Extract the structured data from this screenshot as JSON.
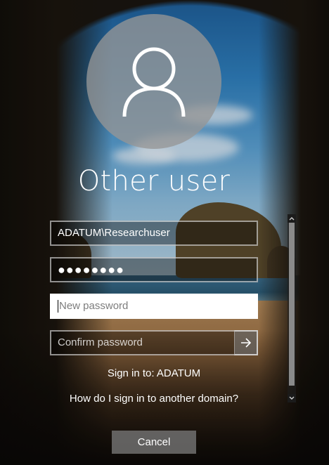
{
  "user": {
    "display_name": "Other user",
    "avatar_icon": "user-silhouette-icon"
  },
  "fields": {
    "username_value": "ADATUM\\Researchuser",
    "old_password_mask": "●●●●●●●●",
    "new_password_placeholder": "New password",
    "confirm_password_placeholder": "Confirm password",
    "submit_icon": "arrow-right-icon"
  },
  "signin_to": "Sign in to: ADATUM",
  "help_link": "How do I sign in to another domain?",
  "cancel_label": "Cancel",
  "colors": {
    "avatar_bg": "#969696",
    "field_border": "#bfbfbf",
    "active_field_bg": "#ffffff",
    "cancel_bg": "#787878",
    "text": "#ffffff"
  }
}
